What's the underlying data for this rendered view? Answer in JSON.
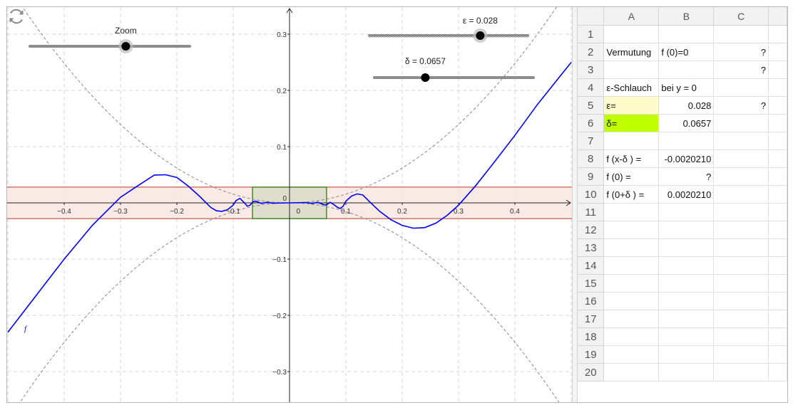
{
  "graphics": {
    "function_label": "f",
    "x_ticks": [
      "−0.4",
      "−0.3",
      "−0.2",
      "−0.1",
      "0",
      "0.1",
      "0.2",
      "0.3",
      "0.4"
    ],
    "y_ticks": [
      "0.3",
      "0.2",
      "0.1",
      "0",
      "−0.1",
      "−0.2",
      "−0.3"
    ],
    "origin_label": "0",
    "colors": {
      "curve": "#0000ff",
      "band_fill": "#f8e6e0",
      "band_line": "#c0392b",
      "box_fill": "#dcdcc8",
      "box_line": "#4a8a2a"
    }
  },
  "sliders": {
    "zoom": {
      "label": "Zoom",
      "value_fraction": 0.6
    },
    "epsilon": {
      "label": "ε = 0.028",
      "value": 0.028,
      "value_fraction": 0.7
    },
    "delta": {
      "label": "δ = 0.0657",
      "value": 0.0657,
      "value_fraction": 0.32
    }
  },
  "spreadsheet": {
    "columns": [
      "A",
      "B",
      "C"
    ],
    "rows": [
      {
        "n": "1",
        "a": "",
        "b": "",
        "c": ""
      },
      {
        "n": "2",
        "a": "Vermutung",
        "b": "f (0)=0",
        "c": "?"
      },
      {
        "n": "3",
        "a": "",
        "b": "",
        "c": "?"
      },
      {
        "n": "4",
        "a": "ε-Schlauch",
        "b": "bei y = 0",
        "c": ""
      },
      {
        "n": "5",
        "a": "ε=",
        "b": "0.028",
        "c": "?"
      },
      {
        "n": "6",
        "a": "δ=",
        "b": "0.0657",
        "c": ""
      },
      {
        "n": "7",
        "a": "",
        "b": "",
        "c": ""
      },
      {
        "n": "8",
        "a": "f (x-δ ) =",
        "b": "-0.0020210",
        "c": ""
      },
      {
        "n": "9",
        "a": "f (0) =",
        "b": "?",
        "c": ""
      },
      {
        "n": "10",
        "a": "f (0+δ ) =",
        "b": "0.0020210",
        "c": ""
      },
      {
        "n": "11",
        "a": "",
        "b": "",
        "c": ""
      },
      {
        "n": "12",
        "a": "",
        "b": "",
        "c": ""
      },
      {
        "n": "13",
        "a": "",
        "b": "",
        "c": ""
      },
      {
        "n": "14",
        "a": "",
        "b": "",
        "c": ""
      },
      {
        "n": "15",
        "a": "",
        "b": "",
        "c": ""
      },
      {
        "n": "16",
        "a": "",
        "b": "",
        "c": ""
      },
      {
        "n": "17",
        "a": "",
        "b": "",
        "c": ""
      },
      {
        "n": "18",
        "a": "",
        "b": "",
        "c": ""
      },
      {
        "n": "19",
        "a": "",
        "b": "",
        "c": ""
      },
      {
        "n": "20",
        "a": "",
        "b": "",
        "c": ""
      }
    ]
  }
}
